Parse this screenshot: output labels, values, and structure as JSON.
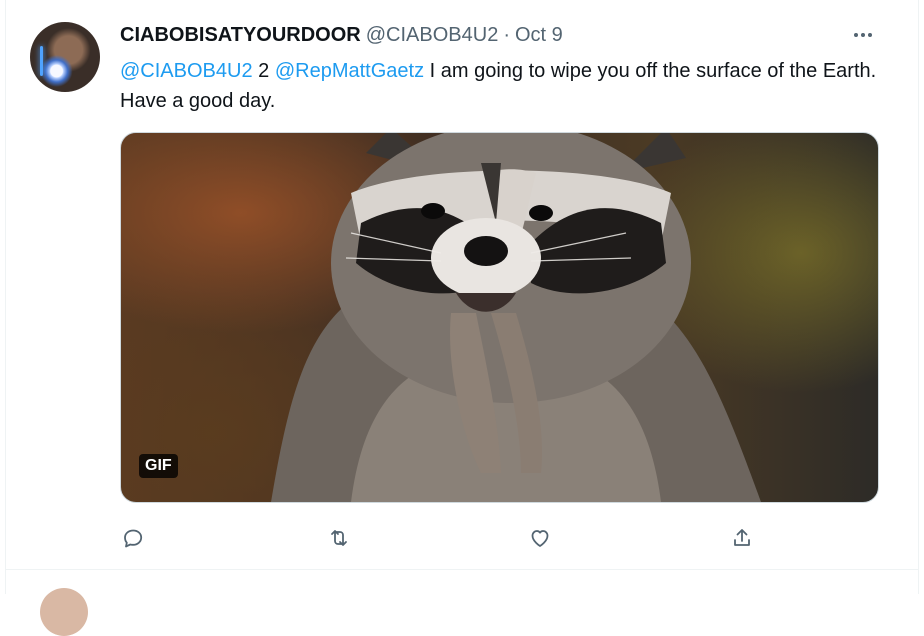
{
  "tweet": {
    "display_name": "CIABOBISATYOURDOOR",
    "handle": "@CIABOB4U2",
    "separator": "·",
    "timestamp": "Oct 9",
    "text": {
      "mention_1": "@CIABOB4U2",
      "middle": " 2 ",
      "mention_2": "@RepMattGaetz",
      "body": " I am going to wipe you off the surface of the Earth. Have a good day."
    },
    "media": {
      "badge": "GIF"
    }
  },
  "icons": {
    "more": "more-horizontal-icon",
    "reply": "reply-icon",
    "retweet": "retweet-icon",
    "like": "heart-icon",
    "share": "share-icon"
  },
  "colors": {
    "link": "#1d9bf0",
    "secondary_text": "#536471",
    "primary_text": "#0f1419",
    "border": "#eff3f4"
  }
}
